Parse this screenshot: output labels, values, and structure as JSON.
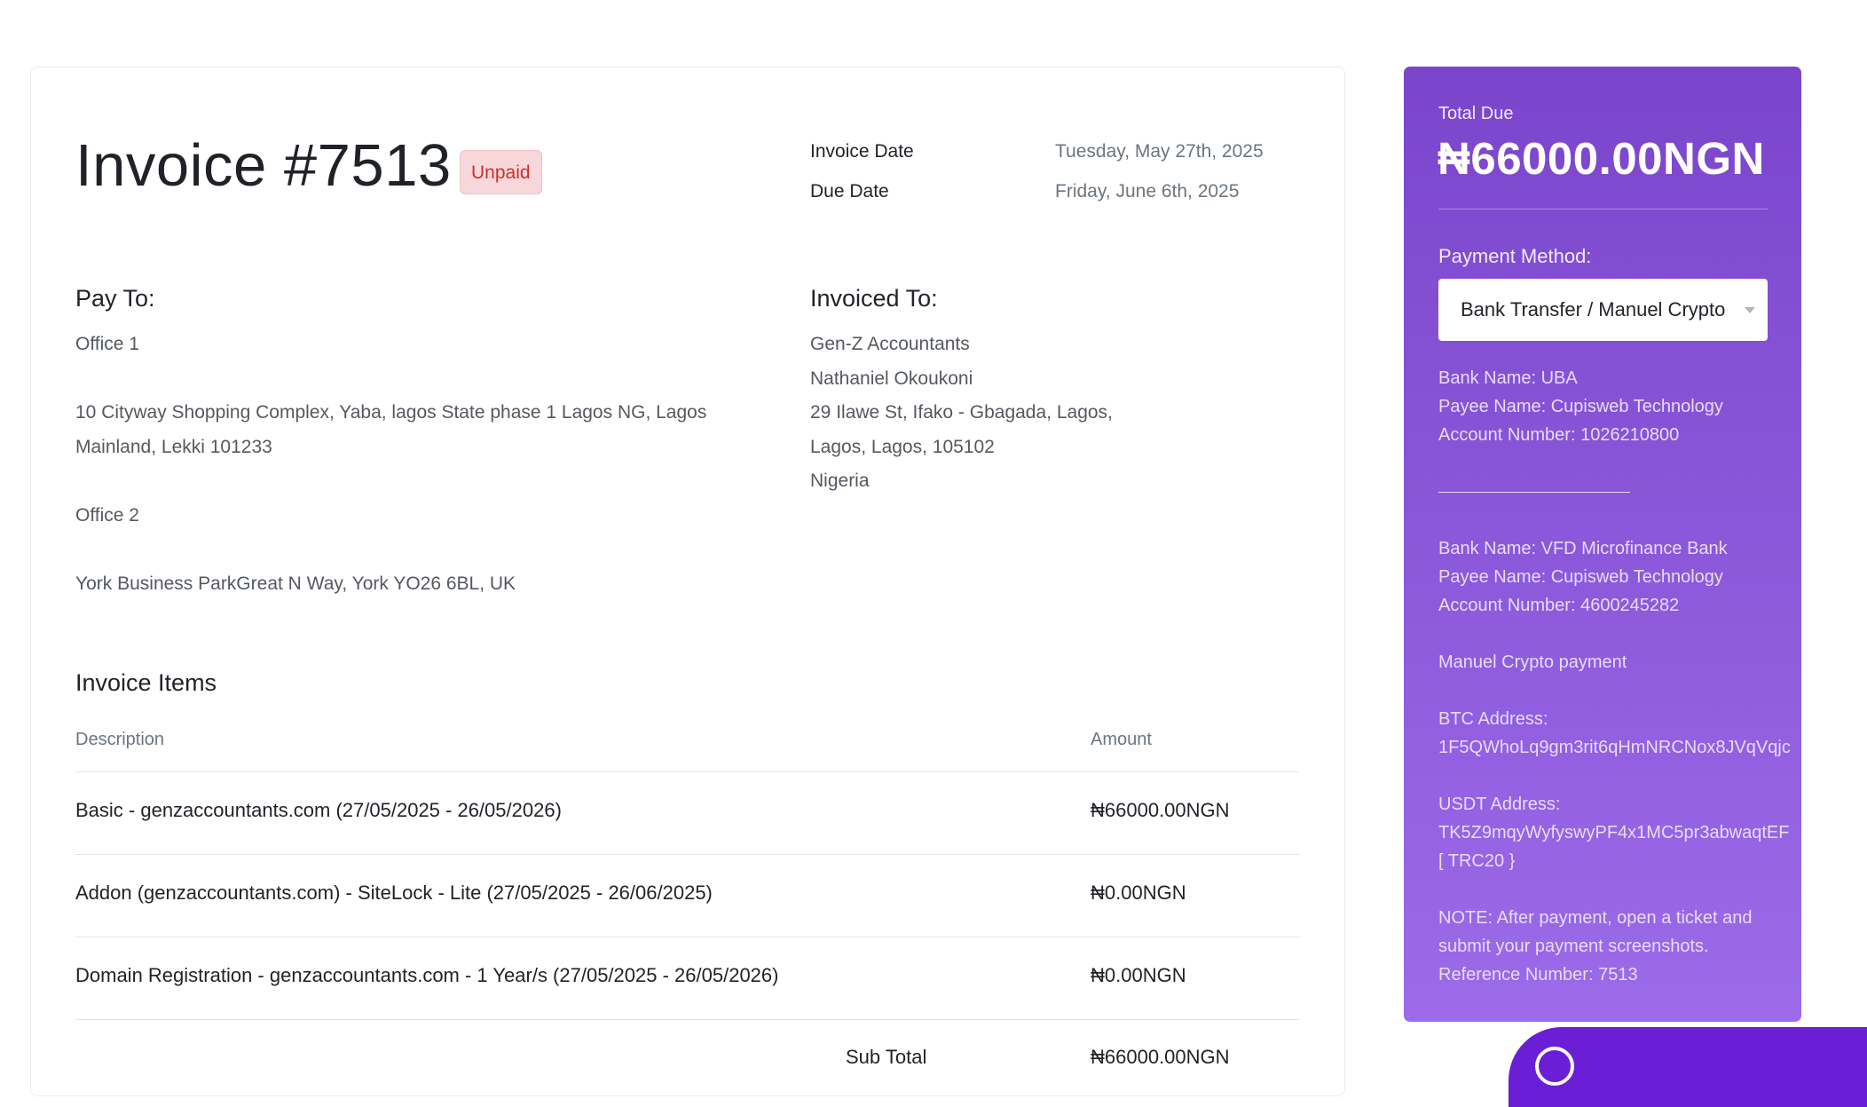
{
  "invoice": {
    "title": "Invoice #7513",
    "status": "Unpaid",
    "invoice_date_label": "Invoice Date",
    "invoice_date": "Tuesday, May 27th, 2025",
    "due_date_label": "Due Date",
    "due_date": "Friday, June 6th, 2025"
  },
  "pay_to": {
    "heading": "Pay To:",
    "lines": [
      "Office 1",
      "",
      "10 Cityway Shopping Complex, Yaba, lagos State phase 1 Lagos NG, Lagos",
      "Mainland, Lekki 101233",
      "",
      "Office 2",
      "",
      "York Business ParkGreat N Way, York YO26 6BL, UK"
    ]
  },
  "invoiced_to": {
    "heading": "Invoiced To:",
    "lines": [
      "Gen-Z Accountants",
      "Nathaniel Okoukoni",
      "29 Ilawe St, Ifako - Gbagada, Lagos,",
      "Lagos, Lagos, 105102",
      "Nigeria"
    ]
  },
  "items": {
    "heading": "Invoice Items",
    "col_description": "Description",
    "col_amount": "Amount",
    "rows": [
      {
        "description": "Basic - genzaccountants.com (27/05/2025 - 26/05/2026)",
        "amount": "₦66000.00NGN"
      },
      {
        "description": "Addon (genzaccountants.com) - SiteLock - Lite (27/05/2025 - 26/06/2025)",
        "amount": "₦0.00NGN"
      },
      {
        "description": "Domain Registration - genzaccountants.com - 1 Year/s (27/05/2025 - 26/05/2026)",
        "amount": "₦0.00NGN"
      }
    ],
    "subtotal_label": "Sub Total",
    "subtotal": "₦66000.00NGN"
  },
  "panel": {
    "total_label": "Total Due",
    "total": "₦66000.00NGN",
    "payment_method_label": "Payment Method:",
    "payment_method": "Bank Transfer / Manuel Crypto",
    "info_lines": [
      "Bank Name: UBA",
      "Payee Name: Cupisweb Technology",
      "Account Number: 1026210800",
      "",
      "",
      "",
      "Bank Name: VFD Microfinance Bank",
      "Payee Name: Cupisweb Technology",
      "Account Number: 4600245282",
      "",
      "Manuel Crypto payment",
      "",
      "BTC Address:",
      "1F5QWhoLq9gm3rit6qHmNRCNox8JVqVqjc",
      "",
      "USDT Address:",
      "TK5Z9mqyWyfyswyPF4x1MC5pr3abwaqtEF",
      "[ TRC20 }",
      "",
      "NOTE: After payment, open a ticket and",
      "submit your payment screenshots.",
      "Reference Number: 7513"
    ]
  },
  "colors": {
    "panel_top": "#7a45cb",
    "panel_bottom": "#9c6be9",
    "badge_bg": "#f8d7da",
    "badge_text": "#c9302c",
    "chat_bubble": "#6a1fd6"
  }
}
